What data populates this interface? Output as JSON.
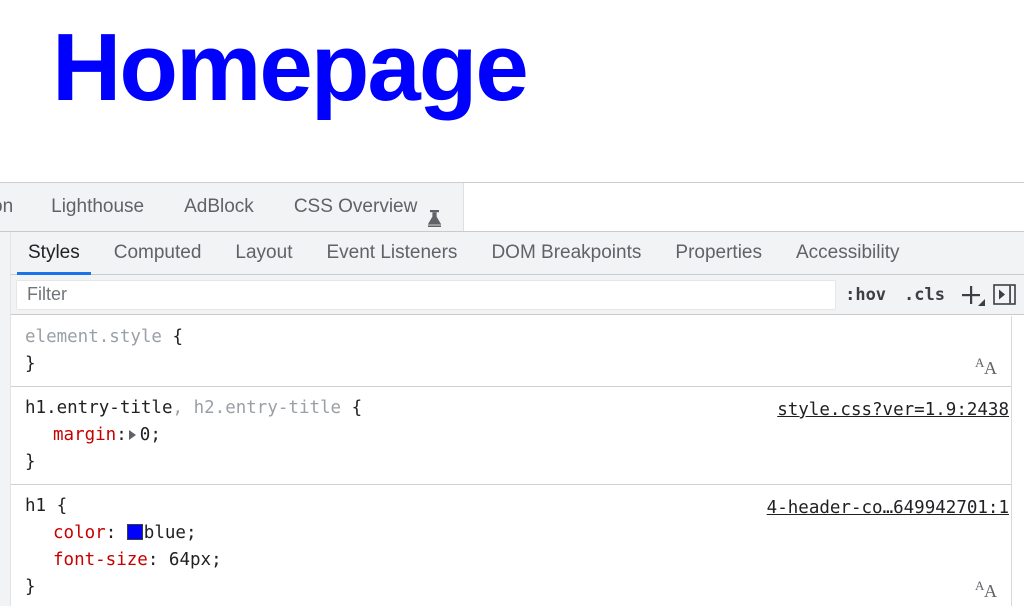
{
  "webpage": {
    "heading": "Homepage",
    "heading_color": "#0000ff"
  },
  "devtools": {
    "main_tabs": [
      {
        "label": "on",
        "icon": "",
        "clipped": true,
        "active": false
      },
      {
        "label": "Lighthouse",
        "icon": "",
        "clipped": false,
        "active": false
      },
      {
        "label": "AdBlock",
        "icon": "",
        "clipped": false,
        "active": false
      },
      {
        "label": "CSS Overview",
        "icon": "flask-icon",
        "clipped": false,
        "active": false
      }
    ],
    "panel_tabs": [
      {
        "label": "Styles",
        "active": true
      },
      {
        "label": "Computed",
        "active": false
      },
      {
        "label": "Layout",
        "active": false
      },
      {
        "label": "Event Listeners",
        "active": false
      },
      {
        "label": "DOM Breakpoints",
        "active": false
      },
      {
        "label": "Properties",
        "active": false
      },
      {
        "label": "Accessibility",
        "active": false
      }
    ],
    "filter_bar": {
      "placeholder": "Filter",
      "value": "",
      "hov_label": ":hov",
      "cls_label": ".cls",
      "new_rule_label": "+",
      "toggle_pane_icon": "show-computed-sidebar-icon"
    },
    "accent_color": "#1a73e8",
    "rules": [
      {
        "selector_match": "element.style",
        "selector_dim": "",
        "open_brace": " {",
        "close_brace": "}",
        "origin": "",
        "declarations": [],
        "font_editor": true
      },
      {
        "selector_match": "h1.entry-title",
        "selector_dim": ", h2.entry-title",
        "open_brace": " {",
        "close_brace": "}",
        "origin": "style.css?ver=1.9:2438",
        "declarations": [
          {
            "property": "margin",
            "separator": ":",
            "has_expand_triangle": true,
            "swatch_color": "",
            "value": "0",
            "terminator": ";"
          }
        ],
        "font_editor": false
      },
      {
        "selector_match": "h1",
        "selector_dim": "",
        "open_brace": " {",
        "close_brace": "}",
        "origin": "4-header-co…649942701:1",
        "declarations": [
          {
            "property": "color",
            "separator": ":",
            "has_expand_triangle": false,
            "swatch_color": "#0000ff",
            "value": "blue",
            "terminator": ";"
          },
          {
            "property": "font-size",
            "separator": ":",
            "has_expand_triangle": false,
            "swatch_color": "",
            "value": "64px",
            "terminator": ";"
          }
        ],
        "font_editor": true
      }
    ]
  }
}
